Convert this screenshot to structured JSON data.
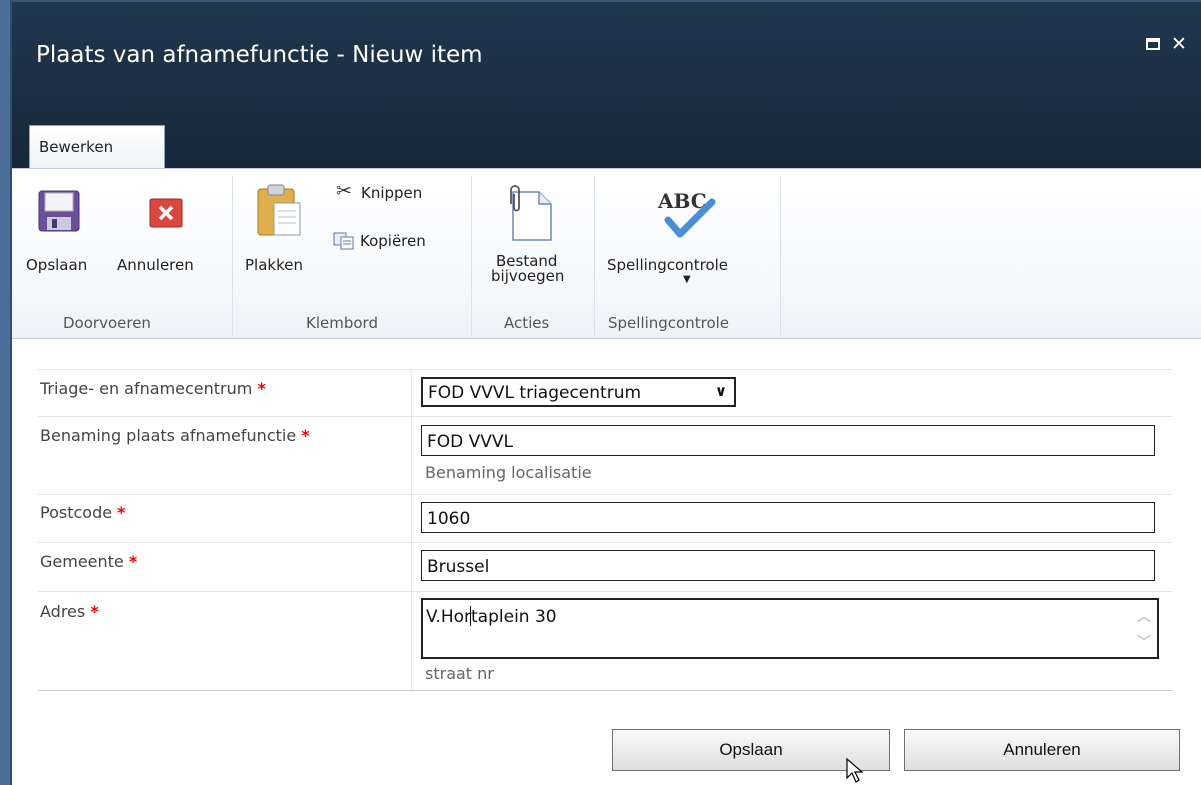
{
  "dialog": {
    "title": "Plaats van afnamefunctie - Nieuw item"
  },
  "tab": {
    "label": "Bewerken"
  },
  "ribbon": {
    "save_label": "Opslaan",
    "cancel_label": "Annuleren",
    "paste_label": "Plakken",
    "cut_label": "Knippen",
    "copy_label": "Kopiëren",
    "attach_label_1": "Bestand",
    "attach_label_2": "bijvoegen",
    "spelling_label": "Spellingcontrole",
    "groups": {
      "commit": "Doorvoeren",
      "clipboard": "Klembord",
      "actions": "Acties",
      "spelling": "Spellingcontrole"
    }
  },
  "form": {
    "required_marker": "*",
    "center": {
      "label": "Triage- en afnamecentrum",
      "value": "FOD VVVL triagecentrum"
    },
    "location_name": {
      "label": "Benaming plaats afnamefunctie",
      "value": "FOD VVVL",
      "hint": "Benaming localisatie"
    },
    "postcode": {
      "label": "Postcode",
      "value": "1060"
    },
    "municipality": {
      "label": "Gemeente",
      "value": "Brussel"
    },
    "address": {
      "label": "Adres",
      "value": "V.Hortaplein 30",
      "hint": "straat nr"
    }
  },
  "buttons": {
    "save": "Opslaan",
    "cancel": "Annuleren"
  },
  "icons": {
    "save": "floppy-disk-icon",
    "cancel": "red-x-icon",
    "paste": "clipboard-icon",
    "cut": "scissors-icon",
    "copy": "copy-icon",
    "attach": "paperclip-document-icon",
    "spelling": "abc-checkmark-icon"
  },
  "colors": {
    "titlebar": "#1b2d41",
    "required": "#ee0000"
  }
}
